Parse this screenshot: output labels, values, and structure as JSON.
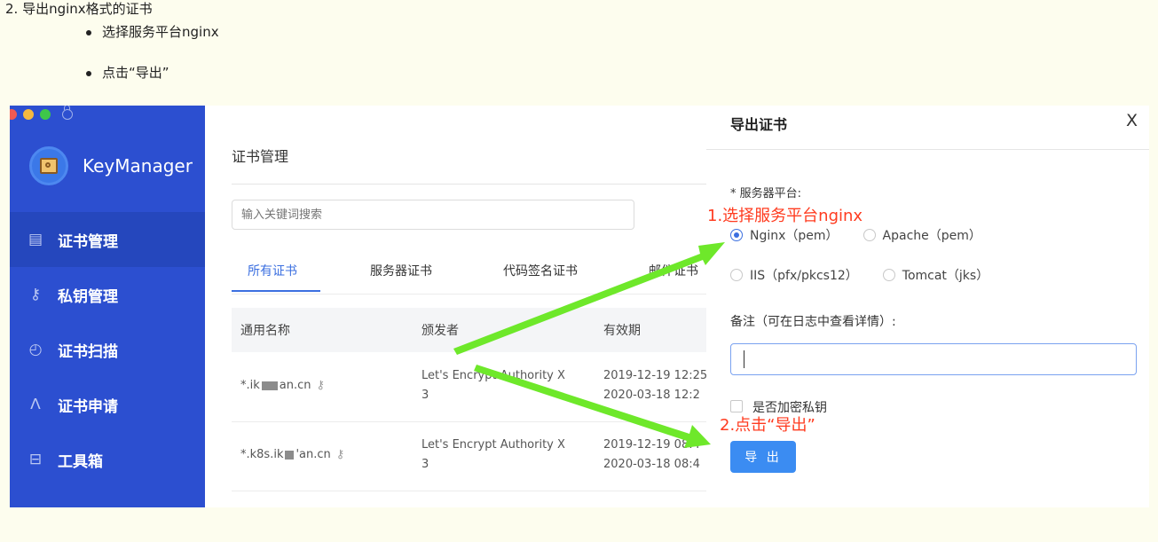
{
  "doc": {
    "heading": "2. 导出nginx格式的证书",
    "bullets": [
      "选择服务平台nginx",
      "点击“导出”"
    ]
  },
  "app": {
    "brand": "KeyManager",
    "nav": [
      {
        "label": "证书管理",
        "icon": "certificate-icon",
        "glyph": "▤",
        "active": true
      },
      {
        "label": "私钥管理",
        "icon": "key-icon",
        "glyph": "⚷",
        "active": false
      },
      {
        "label": "证书扫描",
        "icon": "scan-icon",
        "glyph": "◴",
        "active": false
      },
      {
        "label": "证书申请",
        "icon": "user-icon",
        "glyph": "ᐱ",
        "active": false
      },
      {
        "label": "工具箱",
        "icon": "toolbox-icon",
        "glyph": "⊟",
        "active": false
      }
    ]
  },
  "main": {
    "title": "证书管理",
    "search_placeholder": "输入关键词搜索",
    "tabs": [
      "所有证书",
      "服务器证书",
      "代码签名证书",
      "邮件证书"
    ],
    "columns": [
      "通用名称",
      "颁发者",
      "有效期"
    ],
    "rows": [
      {
        "name_prefix": "*.ik",
        "name_suffix": "an.cn",
        "issuer_1": "Let's Encrypt Authority X",
        "issuer_2": "3",
        "from": "2019-12-19 12:25",
        "to": "2020-03-18 12:2"
      },
      {
        "name_prefix": "*.k8s.ik",
        "name_suffix": "'an.cn",
        "issuer_1": "Let's Encrypt Authority X",
        "issuer_2": "3",
        "from": "2019-12-19 08:4",
        "to": "2020-03-18 08:4"
      }
    ]
  },
  "dialog": {
    "title": "导出证书",
    "close": "X",
    "platform_label": "* 服务器平台:",
    "platforms": [
      "Nginx（pem）",
      "Apache（pem）",
      "IIS（pfx/pkcs12）",
      "Tomcat（jks）"
    ],
    "selected_platform": "Nginx（pem）",
    "remark_label": "备注（可在日志中查看详情）:",
    "remark_value": "",
    "encrypt_label": "是否加密私钥",
    "encrypt_checked": false,
    "export_button": "导 出"
  },
  "annotations": {
    "step1": "1.选择服务平台nginx",
    "step2": "2.点击“导出”",
    "color": "#ff3b1f",
    "arrow_color": "#6ee82a"
  }
}
